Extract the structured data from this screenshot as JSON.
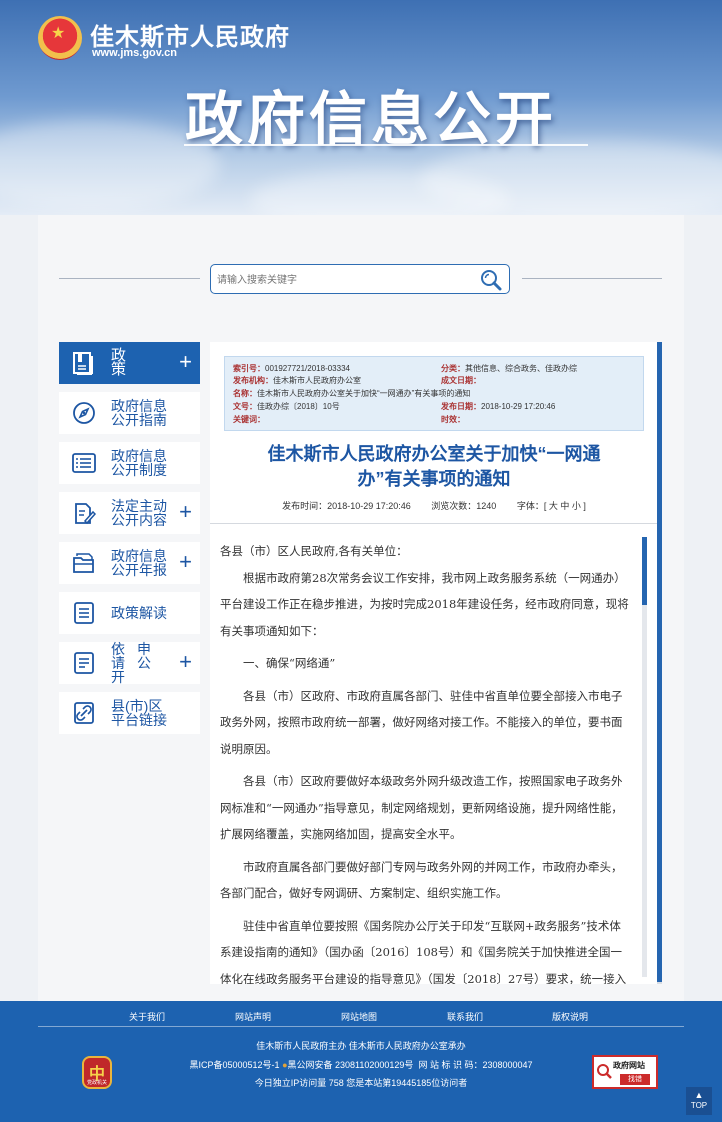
{
  "header": {
    "site_name": "佳木斯市人民政府",
    "site_url": "www.jms.gov.cn",
    "banner_title": "政府信息公开"
  },
  "search": {
    "placeholder": "请输入搜索关键字"
  },
  "sidebar": {
    "items": [
      {
        "label": "政策",
        "plus": "+",
        "icon": "document-book-icon"
      },
      {
        "label": "政府信息公开指南",
        "plus": "",
        "icon": "compass-icon"
      },
      {
        "label": "政府信息公开制度",
        "plus": "",
        "icon": "list-panel-icon"
      },
      {
        "label": "法定主动公开内容",
        "plus": "+",
        "icon": "edit-document-icon"
      },
      {
        "label": "政府信息公开年报",
        "plus": "+",
        "icon": "folder-icon"
      },
      {
        "label": "政策解读",
        "plus": "",
        "icon": "document-lines-icon"
      },
      {
        "label": "依申请公开",
        "plus": "+",
        "icon": "form-icon"
      },
      {
        "label": "县(市)区平台链接",
        "plus": "",
        "icon": "link-icon"
      }
    ]
  },
  "meta": {
    "index_label": "索引号：",
    "index_value": "001927721/2018-03334",
    "category_label": "分类：",
    "category_value": "其他信息、综合政务、佳政办综",
    "publisher_label": "发布机构：",
    "publisher_value": "佳木斯市人民政府办公室",
    "created_label": "成文日期：",
    "created_value": "",
    "name_label": "名称：",
    "name_value": "佳木斯市人民政府办公室关于加快“一网通办”有关事项的通知",
    "docno_label": "文号：",
    "docno_value": "佳政办综〔2018〕10号",
    "pubdate_label": "发布日期：",
    "pubdate_value": "2018-10-29 17:20:46",
    "keywords_label": "关键词：",
    "keywords_value": "",
    "validity_label": "时效：",
    "validity_value": ""
  },
  "article": {
    "title_line1": "佳木斯市人民政府办公室关于加快“一网通",
    "title_line2": "办”有关事项的通知",
    "published": "发布时间：2018-10-29 17:20:46",
    "views": "浏览次数：1240",
    "font_size": "字体：[ 大 中 小 ]",
    "paragraphs": [
      "各县（市）区人民政府,各有关单位：",
      "根据市政府第28次常务会议工作安排，我市网上政务服务系统（一网通办）平台建设工作正在稳步推进，为按时完成2018年建设任务，经市政府同意，现将有关事项通知如下：",
      "一、确保“网络通”",
      "各县（市）区政府、市政府直属各部门、驻佳中省直单位要全部接入市电子政务外网，按照市政府统一部署，做好网络对接工作。不能接入的单位，要书面说明原因。",
      "各县（市）区政府要做好本级政务外网升级改造工作，按照国家电子政务外网标准和“一网通办”指导意见，制定网络规划，更新网络设施，提升网络性能，扩展网络覆盖，实施网络加固，提高安全水平。",
      "市政府直属各部门要做好部门专网与政务外网的并网工作，市政府办牵头，各部门配合，做好专网调研、方案制定、组织实施工作。",
      "驻佳中省直单位要按照《国务院办公厅关于印发“互联网+政务服务”技术体系建设指南的通知》（国办函〔2016〕108号）和《国务院关于加快推进全国一体化在线政务服务平台建设的指导意见》（国发〔2018〕27号）要求，统一接入市级政务外网。"
    ]
  },
  "footer": {
    "links": [
      "关于我们",
      "网站声明",
      "网站地图",
      "联系我们",
      "版权说明"
    ],
    "sponsor": "佳木斯市人民政府主办 佳木斯市人民政府办公室承办",
    "icp": "黑ICP备05000512号-1",
    "police": "黑公网安备 23081102000129号",
    "site_id": "网 站 标 识 码：2308000047",
    "visits": "今日独立IP访问量 758     您是本站第19445185位访问者",
    "badge_text": "党政机关",
    "badge_char": "中",
    "error_line1": "政府网站",
    "error_line2": "找错",
    "top_label": "TOP"
  },
  "colors": {
    "brand_blue": "#1d62b0",
    "title_blue": "#1d56a3",
    "meta_bg": "#e3eef8",
    "error_red": "#cc2b2b"
  }
}
